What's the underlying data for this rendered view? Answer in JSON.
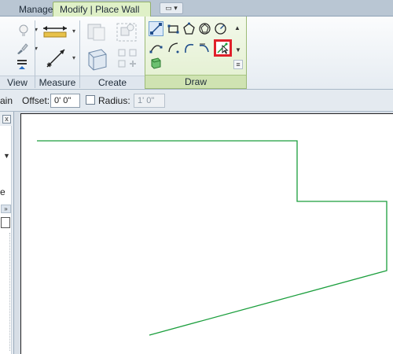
{
  "tabs": {
    "manage": "Manage",
    "modify_place_wall": "Modify | Place Wall"
  },
  "ribbon": {
    "panels": {
      "view": "View",
      "measure": "Measure",
      "create": "Create",
      "draw": "Draw"
    }
  },
  "options_bar": {
    "truncated_label": "ain",
    "offset_label": "Offset:",
    "offset_value": "0'  0\"",
    "radius_label": "Radius:",
    "radius_value": "1'  0\"",
    "radius_checked": false
  },
  "left_panel": {
    "close_glyph": "x",
    "dropdown_glyph": "▼",
    "truncated_text": "e",
    "collapse_glyph": "»"
  },
  "icons": [
    "light-bulb-icon",
    "paint-brush-icon",
    "list-arrow-icon",
    "dimension-ruler-icon",
    "aligned-dimension-icon",
    "assembly-icon",
    "group-icon",
    "model-group-icon",
    "create-similar-icon",
    "line-tool-icon",
    "rectangle-tool-icon",
    "polygon-tool-icon",
    "inscribed-polygon-icon",
    "circle-tool-icon",
    "start-end-arc-icon",
    "center-arc-icon",
    "tangent-arc-icon",
    "fillet-arc-icon",
    "spline-tool-icon",
    "pick-lines-icon",
    "pick-faces-icon",
    "scroll-up-icon",
    "scroll-down-icon",
    "expand-gallery-icon"
  ],
  "colors": {
    "wall_line": "#1a9e3c",
    "highlight": "#e0202a",
    "active_tab": "#dff0c7"
  }
}
